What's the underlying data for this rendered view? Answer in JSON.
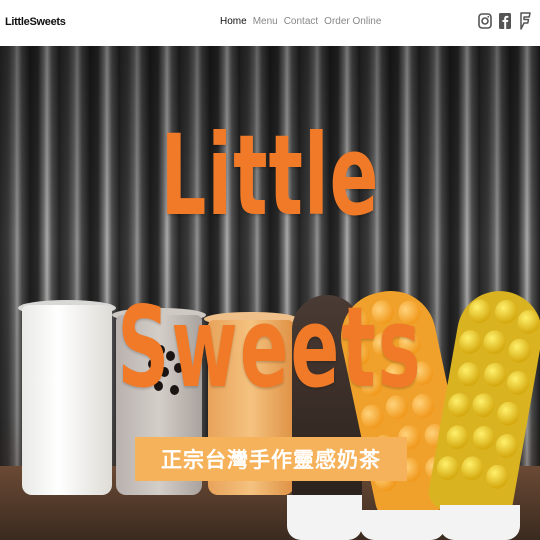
{
  "header": {
    "logo_text": "LittleSweets",
    "nav": [
      {
        "label": "Home",
        "active": true
      },
      {
        "label": "Menu",
        "active": false
      },
      {
        "label": "Contact",
        "active": false
      },
      {
        "label": "Order Online",
        "active": false
      }
    ],
    "social_icons": [
      "instagram-icon",
      "facebook-icon",
      "foursquare-icon"
    ]
  },
  "hero": {
    "title_line_1": "Little",
    "title_line_2": "Sweets",
    "tagline": "正宗台灣手作靈感奶茶"
  },
  "colors": {
    "accent": "#f07a28",
    "tagline_bg": "#f6b25a",
    "nav_active": "#111111",
    "nav_inactive": "#888888"
  }
}
